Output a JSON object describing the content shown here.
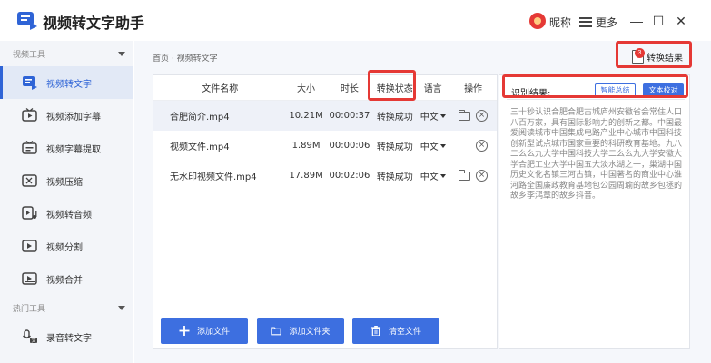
{
  "app": {
    "title": "视频转文字助手",
    "nickname": "昵称",
    "more_label": "更多",
    "minimize": "—",
    "maximize": "☐",
    "close": "✕"
  },
  "sidebar": {
    "sections": [
      {
        "label": "视频工具"
      },
      {
        "label": "热门工具"
      }
    ],
    "items": [
      {
        "label": "视频转文字",
        "icon": "video-to-text-icon",
        "active": true
      },
      {
        "label": "视频添加字幕",
        "icon": "tv-subtitle-icon"
      },
      {
        "label": "视频字幕提取",
        "icon": "tv-extract-icon"
      },
      {
        "label": "视频压缩",
        "icon": "compress-icon"
      },
      {
        "label": "视频转音频",
        "icon": "video-audio-icon"
      },
      {
        "label": "视频分割",
        "icon": "split-icon"
      },
      {
        "label": "视频合并",
        "icon": "merge-icon"
      },
      {
        "label": "录音转文字",
        "icon": "recording-text-icon"
      }
    ]
  },
  "main": {
    "breadcrumb": "首页 · 视频转文字",
    "result_button": "转换结果",
    "result_badge": "3"
  },
  "table": {
    "headers": {
      "name": "文件名称",
      "size": "大小",
      "duration": "时长",
      "status": "转换状态",
      "language": "语言",
      "ops": "操作"
    },
    "rows": [
      {
        "name": "合肥简介.mp4",
        "size": "10.21M",
        "duration": "00:00:37",
        "status": "转换成功",
        "language": "中文",
        "has_folder": true
      },
      {
        "name": "视频文件.mp4",
        "size": "1.89M",
        "duration": "00:00:06",
        "status": "转换成功",
        "language": "中文",
        "has_folder": false
      },
      {
        "name": "无水印视频文件.mp4",
        "size": "17.89M",
        "duration": "00:02:06",
        "status": "转换成功",
        "language": "中文",
        "has_folder": true
      }
    ]
  },
  "buttons": {
    "add_file": "添加文件",
    "add_folder": "添加文件夹",
    "clear_files": "清空文件"
  },
  "result": {
    "label": "识别结果:",
    "smart_summary": "智能总结",
    "text_proofread": "文本校对",
    "text": "三十秒认识合肥合肥古城庐州安徽省会常住人口八百万家，具有国际影响力的创新之都。中国最爱阅读城市中国集成电路产业中心城市中国科技创新型试点城市国家重要的科研教育基地。九八二么么九大学中国科技大学二么么九大学安徽大学合肥工业大学中国五大淡水湖之一，巢湖中国历史文化名镇三河古镇，中国著名的商业中心淮河路全国廉政教育基地包公园周瑜的故乡包拯的故乡李鸿章的故乡抖音。"
  },
  "colors": {
    "accent": "#3d6fe0",
    "highlight": "#e53935"
  }
}
